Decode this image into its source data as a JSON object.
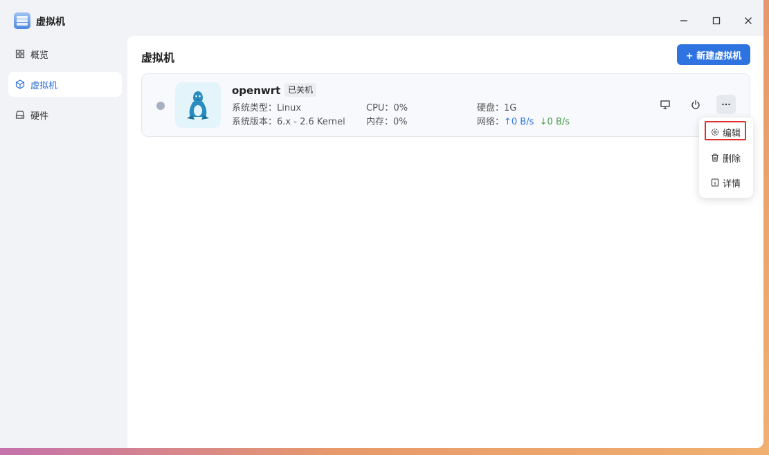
{
  "window": {
    "title": "虚拟机"
  },
  "sidebar": {
    "items": [
      {
        "label": "概览",
        "icon": "grid-icon"
      },
      {
        "label": "虚拟机",
        "icon": "cube-icon",
        "active": true
      },
      {
        "label": "硬件",
        "icon": "drive-icon"
      }
    ]
  },
  "main": {
    "title": "虚拟机",
    "new_button": "+ 新建虚拟机"
  },
  "vm": {
    "name": "openwrt",
    "state": "已关机",
    "os_type_label": "系统类型：",
    "os_type": "Linux",
    "os_version_label": "系统版本：",
    "os_version": "6.x - 2.6 Kernel",
    "cpu_label": "CPU：",
    "cpu": "0%",
    "memory_label": "内存：",
    "memory": "0%",
    "disk_label": "硬盘：",
    "disk": "1G",
    "network_label": "网络：",
    "net_up": "↑0 B/s",
    "net_down": "↓0 B/s"
  },
  "menu": {
    "items": [
      {
        "label": "编辑",
        "icon": "gear-icon",
        "highlighted": true
      },
      {
        "label": "删除",
        "icon": "trash-icon"
      },
      {
        "label": "详情",
        "icon": "info-icon"
      }
    ]
  },
  "colors": {
    "accent": "#2f73e0",
    "highlight": "#e03030",
    "status_off": "#a7b0bf",
    "net_up": "#2f73e0",
    "net_down": "#4a9a4a"
  }
}
